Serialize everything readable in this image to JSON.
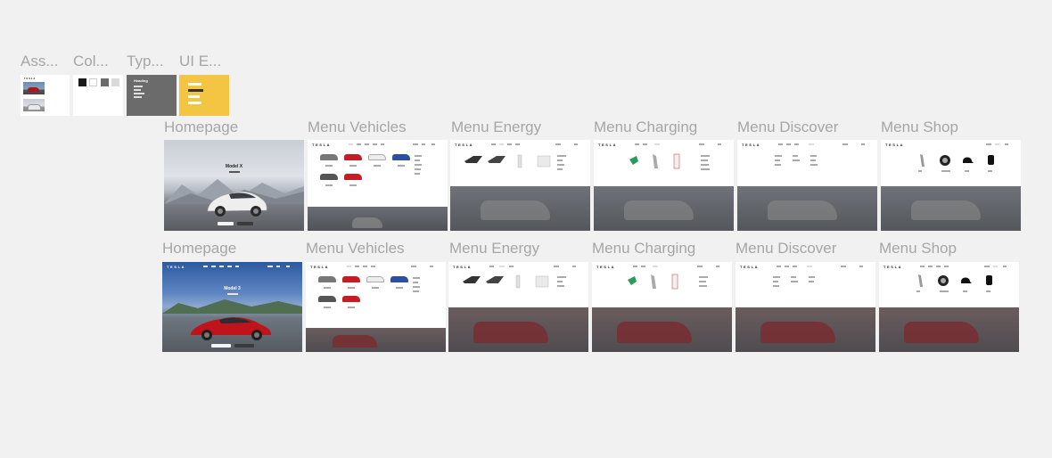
{
  "canvas": {
    "top_labels": [
      "Ass...",
      "Col...",
      "Typ...",
      "UI E..."
    ],
    "typography_heading": "Heading",
    "row1_labels": [
      "Homepage",
      "Menu Vehicles",
      "Menu Energy",
      "Menu Charging",
      "Menu Discover",
      "Menu Shop"
    ],
    "row2_labels": [
      "Homepage",
      "Menu Vehicles",
      "Menu Energy",
      "Menu Charging",
      "Menu Discover",
      "Menu Shop"
    ],
    "row1_hero_title": "Model X",
    "row2_hero_title": "Model 3",
    "logo_text": "TESLA"
  },
  "colors": {
    "canvas_bg": "#f1f1f1",
    "label": "#a6a6a6",
    "swatches": [
      "#1a1a1a",
      "#ffffff",
      "#6b6b6b",
      "#d9d9d9"
    ],
    "typo_card_bg": "#6b6b6b",
    "ui_card_bg": "#f4c542",
    "car_red": "#b3141c",
    "overlay_gray": "#5a5a5a"
  }
}
